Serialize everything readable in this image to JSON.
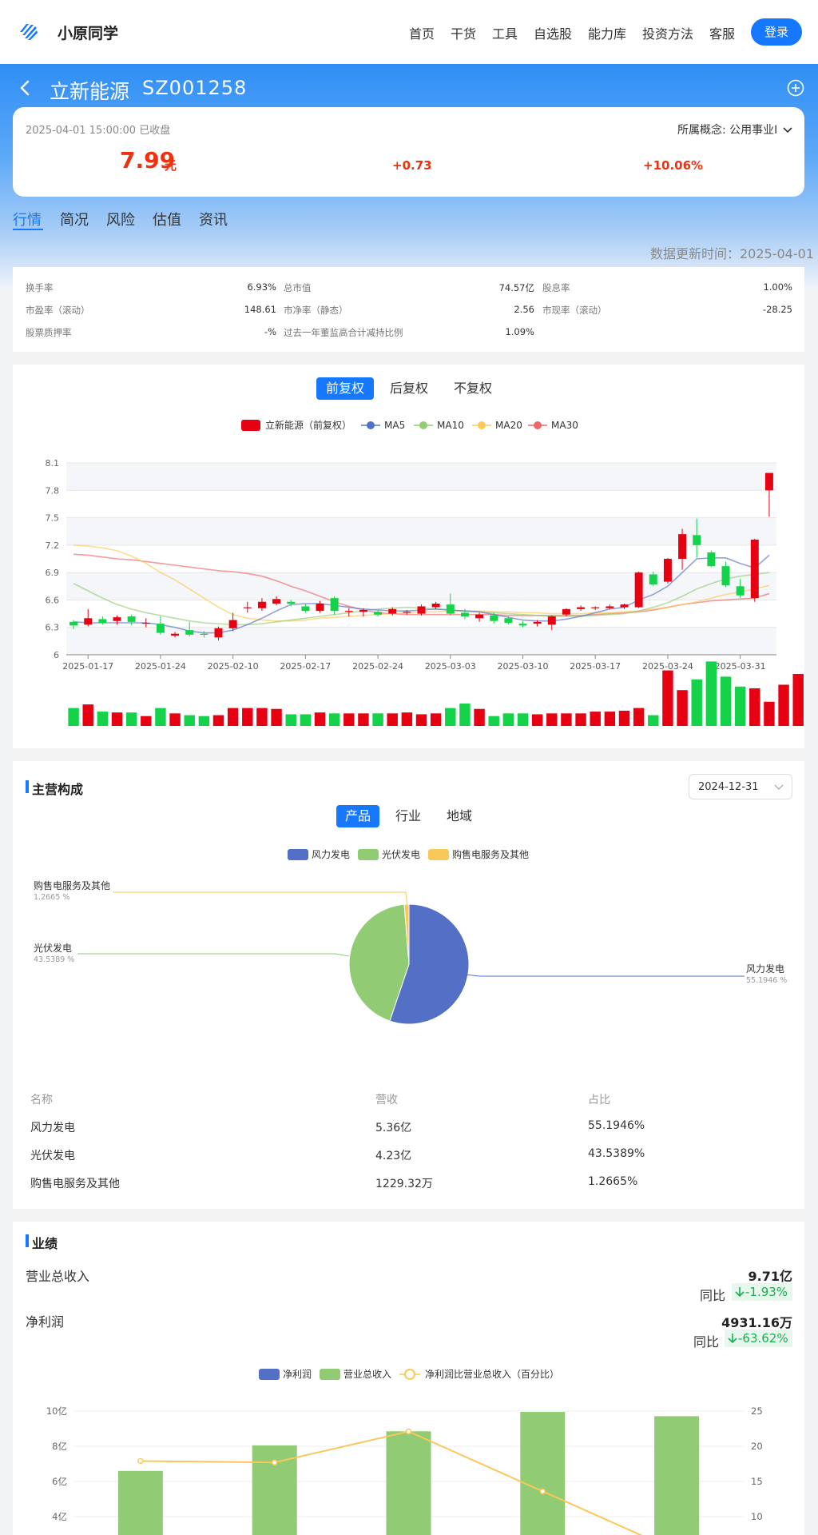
{
  "header": {
    "brand": "小原同学",
    "nav": [
      "首页",
      "干货",
      "工具",
      "自选股",
      "能力库",
      "投资方法",
      "客服"
    ],
    "login": "登录",
    "logo_icon": "logo-stripes-icon"
  },
  "stock": {
    "name": "立新能源",
    "code": "SZ001258",
    "time": "2025-04-01 15:00:00 已收盘",
    "concept": "所属概念: 公用事业I",
    "price": "7.99",
    "unit": "元",
    "change": "+0.73",
    "change_pct": "+10.06%"
  },
  "tabs": [
    "行情",
    "简况",
    "风险",
    "估值",
    "资讯"
  ],
  "update_time": "数据更新时间：2025-04-01",
  "stats": [
    {
      "label": "换手率",
      "value": "6.93%"
    },
    {
      "label": "总市值",
      "value": "74.57亿"
    },
    {
      "label": "股息率",
      "value": "1.00%"
    },
    {
      "label": "市盈率（滚动）",
      "value": "148.61"
    },
    {
      "label": "市净率（静态）",
      "value": "2.56"
    },
    {
      "label": "市现率（滚动）",
      "value": "-28.25"
    },
    {
      "label": "股票质押率",
      "value": "-%"
    },
    {
      "label": "过去一年董监高合计减持比例",
      "value": "1.09%"
    }
  ],
  "kline": {
    "right_tabs": [
      "前复权",
      "后复权",
      "不复权"
    ],
    "legend": [
      "立新能源（前复权）",
      "MA5",
      "MA10",
      "MA20",
      "MA30"
    ],
    "colors": {
      "up": "#e60012",
      "down": "#14d34a",
      "ma5": "#5470c6",
      "ma10": "#91cc75",
      "ma20": "#fac858",
      "ma30": "#ee6666"
    }
  },
  "chart_data": [
    {
      "type": "candlestick",
      "title": "",
      "series_name": "立新能源（前复权）",
      "ylim": [
        6,
        8.1
      ],
      "yticks": [
        6,
        6.3,
        6.6,
        6.9,
        7.2,
        7.5,
        7.8,
        8.1
      ],
      "xticks": [
        "2025-01-17",
        "2025-01-24",
        "2025-02-10",
        "2025-02-17",
        "2025-02-24",
        "2025-03-03",
        "2025-03-10",
        "2025-03-17",
        "2025-03-24",
        "2025-03-31"
      ],
      "candles": [
        {
          "o": 6.36,
          "c": 6.32,
          "h": 6.38,
          "l": 6.28
        },
        {
          "o": 6.33,
          "c": 6.4,
          "h": 6.5,
          "l": 6.31
        },
        {
          "o": 6.39,
          "c": 6.35,
          "h": 6.42,
          "l": 6.33
        },
        {
          "o": 6.37,
          "c": 6.41,
          "h": 6.43,
          "l": 6.33
        },
        {
          "o": 6.42,
          "c": 6.36,
          "h": 6.44,
          "l": 6.32
        },
        {
          "o": 6.34,
          "c": 6.35,
          "h": 6.4,
          "l": 6.3
        },
        {
          "o": 6.34,
          "c": 6.24,
          "h": 6.42,
          "l": 6.22
        },
        {
          "o": 6.21,
          "c": 6.23,
          "h": 6.25,
          "l": 6.19
        },
        {
          "o": 6.27,
          "c": 6.22,
          "h": 6.36,
          "l": 6.2
        },
        {
          "o": 6.23,
          "c": 6.22,
          "h": 6.26,
          "l": 6.19
        },
        {
          "o": 6.19,
          "c": 6.29,
          "h": 6.31,
          "l": 6.16
        },
        {
          "o": 6.29,
          "c": 6.38,
          "h": 6.46,
          "l": 6.26
        },
        {
          "o": 6.52,
          "c": 6.52,
          "h": 6.58,
          "l": 6.46
        },
        {
          "o": 6.51,
          "c": 6.58,
          "h": 6.62,
          "l": 6.48
        },
        {
          "o": 6.56,
          "c": 6.61,
          "h": 6.64,
          "l": 6.54
        },
        {
          "o": 6.58,
          "c": 6.56,
          "h": 6.6,
          "l": 6.53
        },
        {
          "o": 6.53,
          "c": 6.48,
          "h": 6.56,
          "l": 6.46
        },
        {
          "o": 6.48,
          "c": 6.56,
          "h": 6.59,
          "l": 6.46
        },
        {
          "o": 6.62,
          "c": 6.48,
          "h": 6.64,
          "l": 6.44
        },
        {
          "o": 6.47,
          "c": 6.48,
          "h": 6.51,
          "l": 6.42
        },
        {
          "o": 6.47,
          "c": 6.49,
          "h": 6.51,
          "l": 6.42
        },
        {
          "o": 6.47,
          "c": 6.44,
          "h": 6.49,
          "l": 6.42
        },
        {
          "o": 6.45,
          "c": 6.5,
          "h": 6.52,
          "l": 6.43
        },
        {
          "o": 6.47,
          "c": 6.47,
          "h": 6.49,
          "l": 6.44
        },
        {
          "o": 6.45,
          "c": 6.53,
          "h": 6.55,
          "l": 6.43
        },
        {
          "o": 6.52,
          "c": 6.56,
          "h": 6.58,
          "l": 6.5
        },
        {
          "o": 6.55,
          "c": 6.45,
          "h": 6.67,
          "l": 6.43
        },
        {
          "o": 6.46,
          "c": 6.42,
          "h": 6.5,
          "l": 6.39
        },
        {
          "o": 6.4,
          "c": 6.44,
          "h": 6.46,
          "l": 6.36
        },
        {
          "o": 6.43,
          "c": 6.37,
          "h": 6.46,
          "l": 6.34
        },
        {
          "o": 6.4,
          "c": 6.35,
          "h": 6.42,
          "l": 6.33
        },
        {
          "o": 6.34,
          "c": 6.32,
          "h": 6.37,
          "l": 6.3
        },
        {
          "o": 6.34,
          "c": 6.36,
          "h": 6.38,
          "l": 6.31
        },
        {
          "o": 6.33,
          "c": 6.42,
          "h": 6.43,
          "l": 6.27
        },
        {
          "o": 6.44,
          "c": 6.5,
          "h": 6.51,
          "l": 6.42
        },
        {
          "o": 6.5,
          "c": 6.52,
          "h": 6.54,
          "l": 6.48
        },
        {
          "o": 6.51,
          "c": 6.52,
          "h": 6.53,
          "l": 6.49
        },
        {
          "o": 6.51,
          "c": 6.53,
          "h": 6.55,
          "l": 6.5
        },
        {
          "o": 6.52,
          "c": 6.55,
          "h": 6.56,
          "l": 6.5
        },
        {
          "o": 6.52,
          "c": 6.9,
          "h": 6.91,
          "l": 6.51
        },
        {
          "o": 6.88,
          "c": 6.77,
          "h": 6.91,
          "l": 6.75
        },
        {
          "o": 6.8,
          "c": 7.05,
          "h": 7.06,
          "l": 6.78
        },
        {
          "o": 7.05,
          "c": 7.32,
          "h": 7.38,
          "l": 6.93
        },
        {
          "o": 7.31,
          "c": 7.2,
          "h": 7.49,
          "l": 7.06
        },
        {
          "o": 7.12,
          "c": 6.97,
          "h": 7.14,
          "l": 6.96
        },
        {
          "o": 6.97,
          "c": 6.76,
          "h": 7.02,
          "l": 6.74
        },
        {
          "o": 6.75,
          "c": 6.65,
          "h": 6.83,
          "l": 6.62
        },
        {
          "o": 6.62,
          "c": 7.26,
          "h": 7.27,
          "l": 6.58
        },
        {
          "o": 7.8,
          "c": 7.99,
          "h": 7.99,
          "l": 7.51
        }
      ],
      "ma5": [
        6.36,
        6.35,
        6.35,
        6.35,
        6.35,
        6.35,
        6.33,
        6.3,
        6.26,
        6.24,
        6.24,
        6.27,
        6.33,
        6.4,
        6.48,
        6.55,
        6.56,
        6.56,
        6.54,
        6.52,
        6.5,
        6.49,
        6.48,
        6.48,
        6.49,
        6.5,
        6.49,
        6.48,
        6.47,
        6.44,
        6.41,
        6.38,
        6.37,
        6.37,
        6.39,
        6.42,
        6.46,
        6.5,
        6.52,
        6.6,
        6.66,
        6.75,
        6.9,
        7.05,
        7.06,
        7.06,
        7.0,
        6.95,
        7.09
      ],
      "ma10": [
        6.78,
        6.7,
        6.62,
        6.55,
        6.5,
        6.46,
        6.43,
        6.4,
        6.37,
        6.35,
        6.34,
        6.33,
        6.33,
        6.34,
        6.36,
        6.38,
        6.4,
        6.42,
        6.44,
        6.46,
        6.48,
        6.5,
        6.51,
        6.52,
        6.51,
        6.5,
        6.49,
        6.48,
        6.47,
        6.46,
        6.45,
        6.44,
        6.43,
        6.42,
        6.42,
        6.42,
        6.43,
        6.44,
        6.45,
        6.48,
        6.52,
        6.57,
        6.64,
        6.72,
        6.78,
        6.83,
        6.86,
        6.88,
        6.9
      ],
      "ma20": [
        7.2,
        7.19,
        7.17,
        7.14,
        7.08,
        7.0,
        6.9,
        6.82,
        6.72,
        6.62,
        6.52,
        6.44,
        6.4,
        6.38,
        6.37,
        6.37,
        6.38,
        6.4,
        6.41,
        6.42,
        6.43,
        6.44,
        6.45,
        6.46,
        6.47,
        6.47,
        6.48,
        6.48,
        6.48,
        6.47,
        6.47,
        6.46,
        6.46,
        6.45,
        6.45,
        6.45,
        6.46,
        6.46,
        6.47,
        6.48,
        6.5,
        6.52,
        6.55,
        6.58,
        6.62,
        6.66,
        6.69,
        6.72,
        6.76
      ],
      "ma30": [
        7.1,
        7.09,
        7.07,
        7.05,
        7.04,
        7.02,
        7.0,
        6.98,
        6.96,
        6.94,
        6.92,
        6.91,
        6.89,
        6.86,
        6.81,
        6.75,
        6.7,
        6.64,
        6.58,
        6.53,
        6.49,
        6.46,
        6.45,
        6.44,
        6.44,
        6.44,
        6.44,
        6.44,
        6.44,
        6.44,
        6.43,
        6.43,
        6.43,
        6.43,
        6.43,
        6.43,
        6.44,
        6.45,
        6.46,
        6.47,
        6.49,
        6.52,
        6.55,
        6.57,
        6.59,
        6.6,
        6.61,
        6.62,
        6.67
      ],
      "volume_direction": "same as candles",
      "volume": [
        20,
        24,
        16,
        15,
        15,
        11,
        20,
        14,
        12,
        11,
        12,
        20,
        20,
        20,
        19,
        13,
        13,
        15,
        14,
        14,
        14,
        14,
        14,
        15,
        13,
        14,
        20,
        25,
        19,
        11,
        14,
        14,
        13,
        14,
        14,
        14,
        16,
        16,
        17,
        20,
        12,
        62,
        40,
        52,
        72,
        55,
        44,
        42,
        27,
        46,
        58
      ]
    },
    {
      "type": "pie",
      "title": "",
      "legend": [
        "风力发电",
        "光伏发电",
        "购售电服务及其他"
      ],
      "labels": [
        "风力发电",
        "光伏发电",
        "购售电服务及其他"
      ],
      "values": [
        55.1946,
        43.5389,
        1.2665
      ],
      "colors": [
        "#5470c6",
        "#91cc75",
        "#fac858"
      ]
    },
    {
      "type": "bar+line",
      "title": "",
      "legend": [
        "净利润",
        "营业总收入",
        "净利润比营业总收入（百分比）"
      ],
      "y_left_ticks": [
        "10亿",
        "8亿",
        "6亿",
        "4亿"
      ],
      "y_right_ticks": [
        "25",
        "20",
        "15",
        "10"
      ],
      "series": [
        {
          "name": "营业总收入",
          "unit": "亿",
          "values": [
            6.6,
            8.05,
            8.85,
            9.95,
            9.71
          ]
        },
        {
          "name": "净利润比营业总收入（百分比）",
          "values": [
            17.9,
            17.7,
            22.1,
            13.6,
            5.1
          ]
        }
      ]
    }
  ],
  "composition": {
    "title": "主营构成",
    "date": "2024-12-31",
    "tabs": [
      "产品",
      "行业",
      "地域"
    ],
    "pie_labels": [
      {
        "name": "购售电服务及其他",
        "pct": "1.2665 %"
      },
      {
        "name": "光伏发电",
        "pct": "43.5389 %"
      },
      {
        "name": "风力发电",
        "pct": "55.1946 %"
      }
    ],
    "table": {
      "headers": [
        "名称",
        "营收",
        "占比"
      ],
      "rows": [
        [
          "风力发电",
          "5.36亿",
          "55.1946%"
        ],
        [
          "光伏发电",
          "4.23亿",
          "43.5389%"
        ],
        [
          "购售电服务及其他",
          "1229.32万",
          "1.2665%"
        ]
      ]
    }
  },
  "performance": {
    "title": "业绩",
    "revenue_label": "营业总收入",
    "revenue_value": "9.71亿",
    "yoy_label": "同比",
    "revenue_yoy": "-1.93%",
    "profit_label": "净利润",
    "profit_value": "4931.16万",
    "profit_yoy": "-63.62%"
  }
}
